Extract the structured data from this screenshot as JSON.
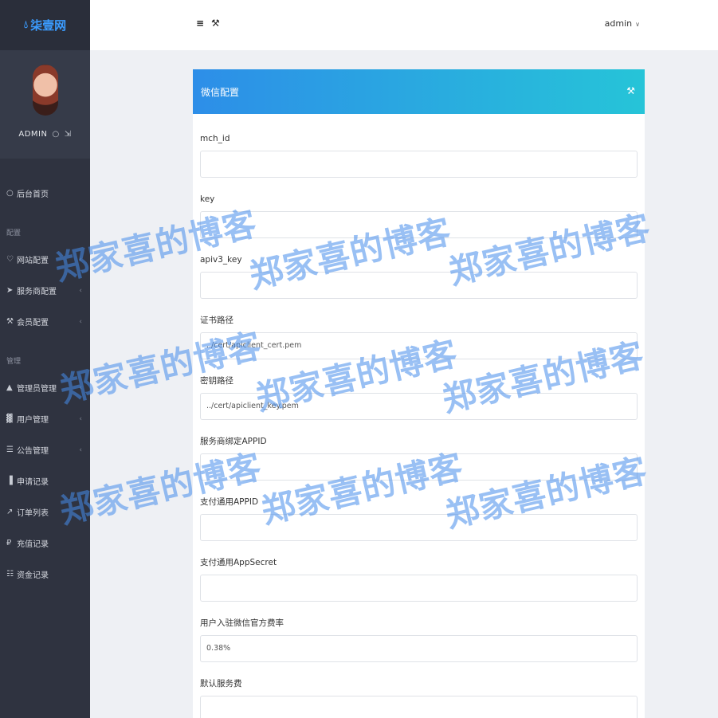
{
  "brand": {
    "name": "柒壹网",
    "icon": "drop-icon"
  },
  "profile": {
    "name": "ADMIN",
    "icons": [
      "drop-icon",
      "logout-icon"
    ]
  },
  "sidebar": {
    "top_items": [
      {
        "label": "后台首页",
        "icon": "drop-icon",
        "has_caret": false
      }
    ],
    "groups": [
      {
        "title": "配置",
        "items": [
          {
            "label": "网站配置",
            "icon": "heart-icon",
            "has_caret": true
          },
          {
            "label": "服务商配置",
            "icon": "send-icon",
            "has_caret": true
          },
          {
            "label": "会员配置",
            "icon": "wrench-icon",
            "has_caret": true
          }
        ]
      },
      {
        "title": "管理",
        "items": [
          {
            "label": "管理员管理",
            "icon": "user-icon",
            "has_caret": true
          },
          {
            "label": "用户管理",
            "icon": "users-icon",
            "has_caret": true
          },
          {
            "label": "公告管理",
            "icon": "notice-icon",
            "has_caret": true
          },
          {
            "label": "申请记录",
            "icon": "bar-chart-icon",
            "has_caret": false
          },
          {
            "label": "订单列表",
            "icon": "line-chart-icon",
            "has_caret": false
          },
          {
            "label": "充值记录",
            "icon": "ruble-icon",
            "has_caret": false
          },
          {
            "label": "资金记录",
            "icon": "list-icon",
            "has_caret": false
          }
        ]
      }
    ]
  },
  "header": {
    "user_label": "admin",
    "icons": [
      "menu-icon",
      "wrench-icon",
      "chevron-down-icon"
    ]
  },
  "card": {
    "title": "微信配置",
    "fields": [
      {
        "label": "mch_id",
        "value": ""
      },
      {
        "label": "key",
        "value": ""
      },
      {
        "label": "apiv3_key",
        "value": ""
      },
      {
        "label": "证书路径",
        "value": "../cert/apiclient_cert.pem"
      },
      {
        "label": "密钥路径",
        "value": "../cert/apiclient_key.pem"
      },
      {
        "label": "服务商绑定APPID",
        "value": ""
      },
      {
        "label": "支付通用APPID",
        "value": ""
      },
      {
        "label": "支付通用AppSecret",
        "value": ""
      },
      {
        "label": "用户入驻微信官方费率",
        "value": "0.38%"
      },
      {
        "label": "默认服务费",
        "value": ""
      }
    ]
  },
  "watermark": "郑家喜的博客",
  "colors": {
    "sidebar_bg": "#2f3340",
    "brand": "#3b9cff",
    "header_gradient_start": "#2d8ee8",
    "header_gradient_end": "#26c4d8"
  }
}
